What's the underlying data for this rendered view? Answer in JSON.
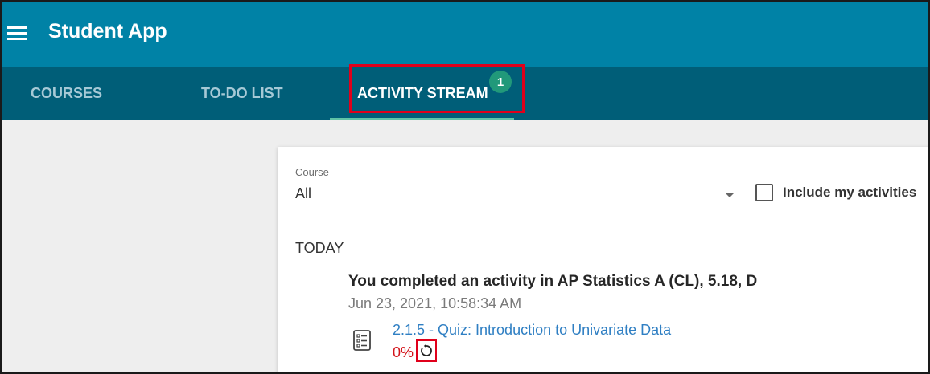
{
  "app": {
    "title": "Student App"
  },
  "icons": {
    "menu": "menu-icon",
    "dropdown": "chevron-down-icon",
    "quiz": "quiz-list-icon",
    "retry": "retry-icon"
  },
  "colors": {
    "appbar": "#0082a6",
    "tabbar": "#005e78",
    "badge": "#21997a",
    "link": "#2f7fc3",
    "score": "#d3131a",
    "highlight": "#e0001b"
  },
  "tabs": [
    {
      "label": "COURSES",
      "active": false
    },
    {
      "label": "TO-DO LIST",
      "active": false
    },
    {
      "label": "ACTIVITY STREAM",
      "active": true,
      "badge": "1"
    }
  ],
  "filters": {
    "course_label": "Course",
    "course_value": "All",
    "include_label": "Include my activities",
    "include_checked": false
  },
  "stream": {
    "section": "TODAY",
    "item": {
      "heading": "You completed an activity in AP Statistics A (CL), 5.18, D",
      "timestamp": "Jun 23, 2021, 10:58:34 AM",
      "link": "2.1.5 - Quiz: Introduction to Univariate Data",
      "score": "0%"
    }
  }
}
